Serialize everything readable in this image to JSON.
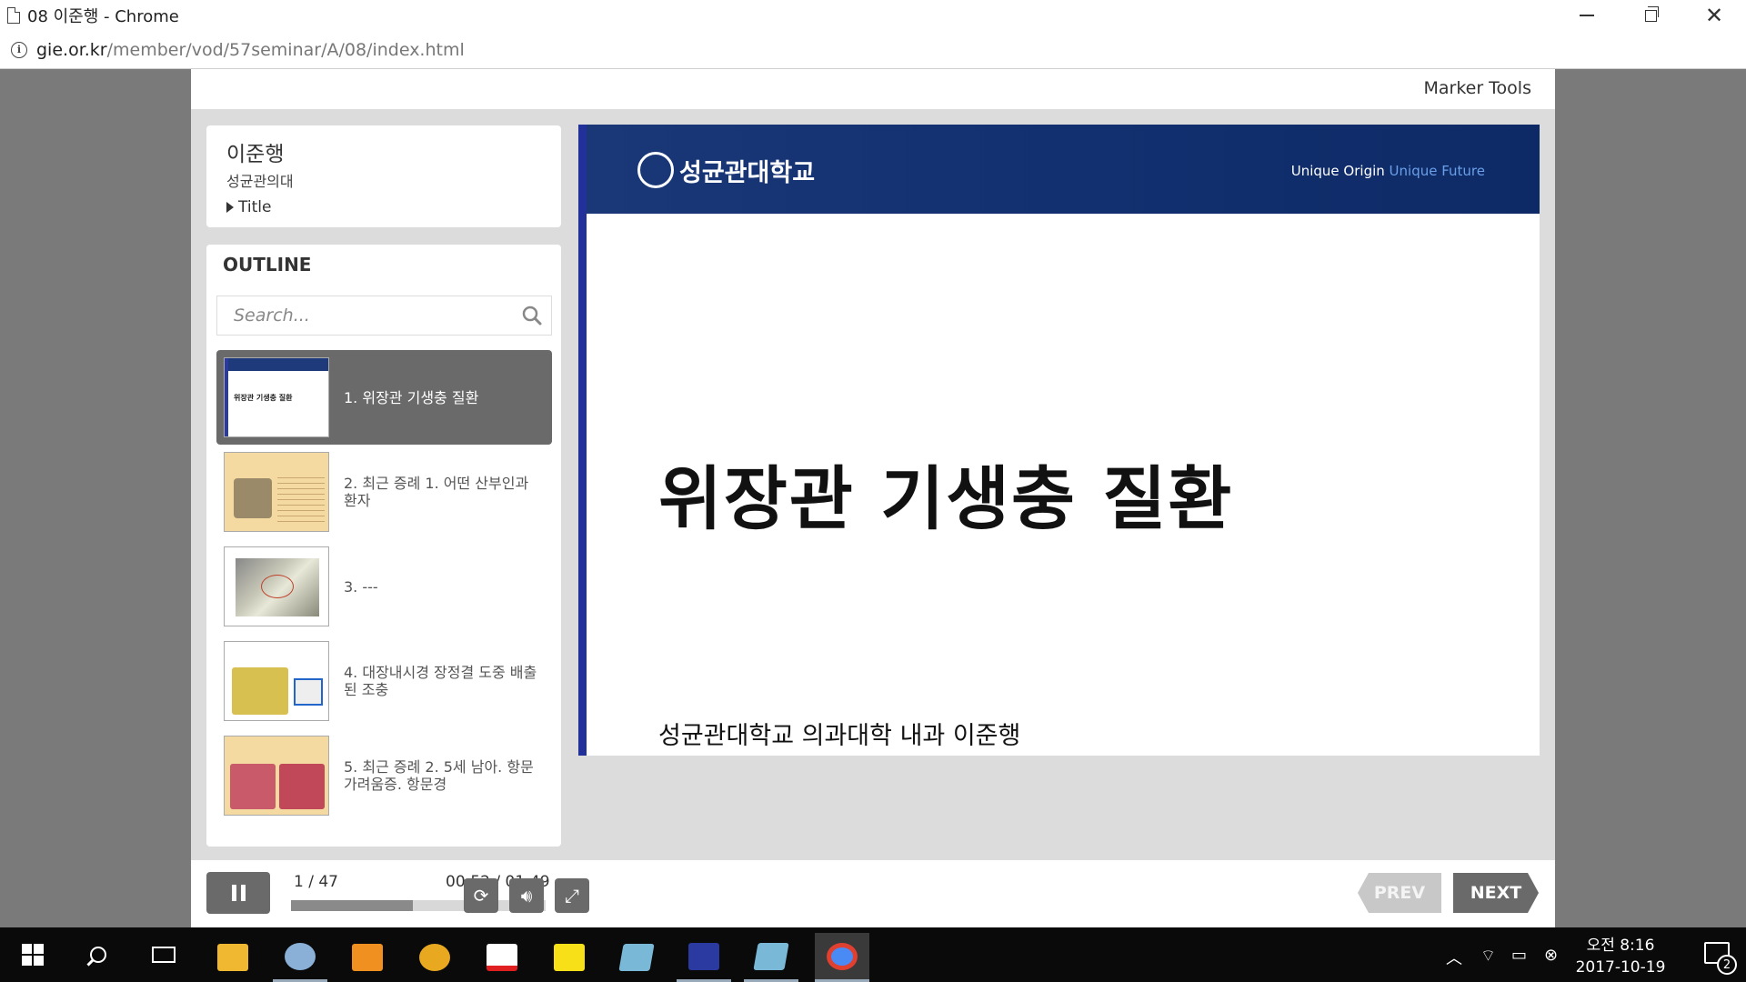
{
  "window": {
    "title": "08 이준행 - Chrome",
    "url_host": "gie.or.kr",
    "url_path": "/member/vod/57seminar/A/08/index.html"
  },
  "player": {
    "marker_tools": "Marker Tools",
    "presenter": {
      "name": "이준행",
      "affiliation": "성균관의대",
      "title_toggle": "Title"
    },
    "outline": {
      "heading": "OUTLINE",
      "search_placeholder": "Search...",
      "slides": [
        {
          "label": "1. 위장관 기생충 질환",
          "active": true
        },
        {
          "label": "2. 최근 증례 1. 어떤 산부인과 환자",
          "active": false
        },
        {
          "label": "3. ---",
          "active": false
        },
        {
          "label": "4. 대장내시경 장정결 도중 배출된 조충",
          "active": false
        },
        {
          "label": "5. 최근 증례 2. 5세 남아. 항문가려움증. 항문경",
          "active": false
        }
      ]
    },
    "slide": {
      "university": "성균관대학교",
      "slogan_a": "Unique Origin",
      "slogan_b": "Unique Future",
      "title": "위장관 기생충 질환",
      "subtitle": "성균관대학교 의과대학 내과 이준행"
    },
    "controls": {
      "current_slide": "1",
      "total_slides": "/ 47",
      "elapsed": "00:52",
      "duration": "/ 01:49",
      "progress_fraction": 0.477,
      "prev_label": "PREV",
      "next_label": "NEXT"
    }
  },
  "taskbar": {
    "time": "오전 8:16",
    "date": "2017-10-19",
    "notification_count": "2",
    "apps": [
      "file-explorer",
      "paint",
      "media-player",
      "people",
      "acrobat",
      "kakaotalk",
      "notes",
      "floppy-app",
      "notes-2",
      "chrome"
    ],
    "colors": {
      "kakaotalk": "#f7e017",
      "acrobat": "#e02020",
      "chrome": "#4a8af4"
    }
  }
}
